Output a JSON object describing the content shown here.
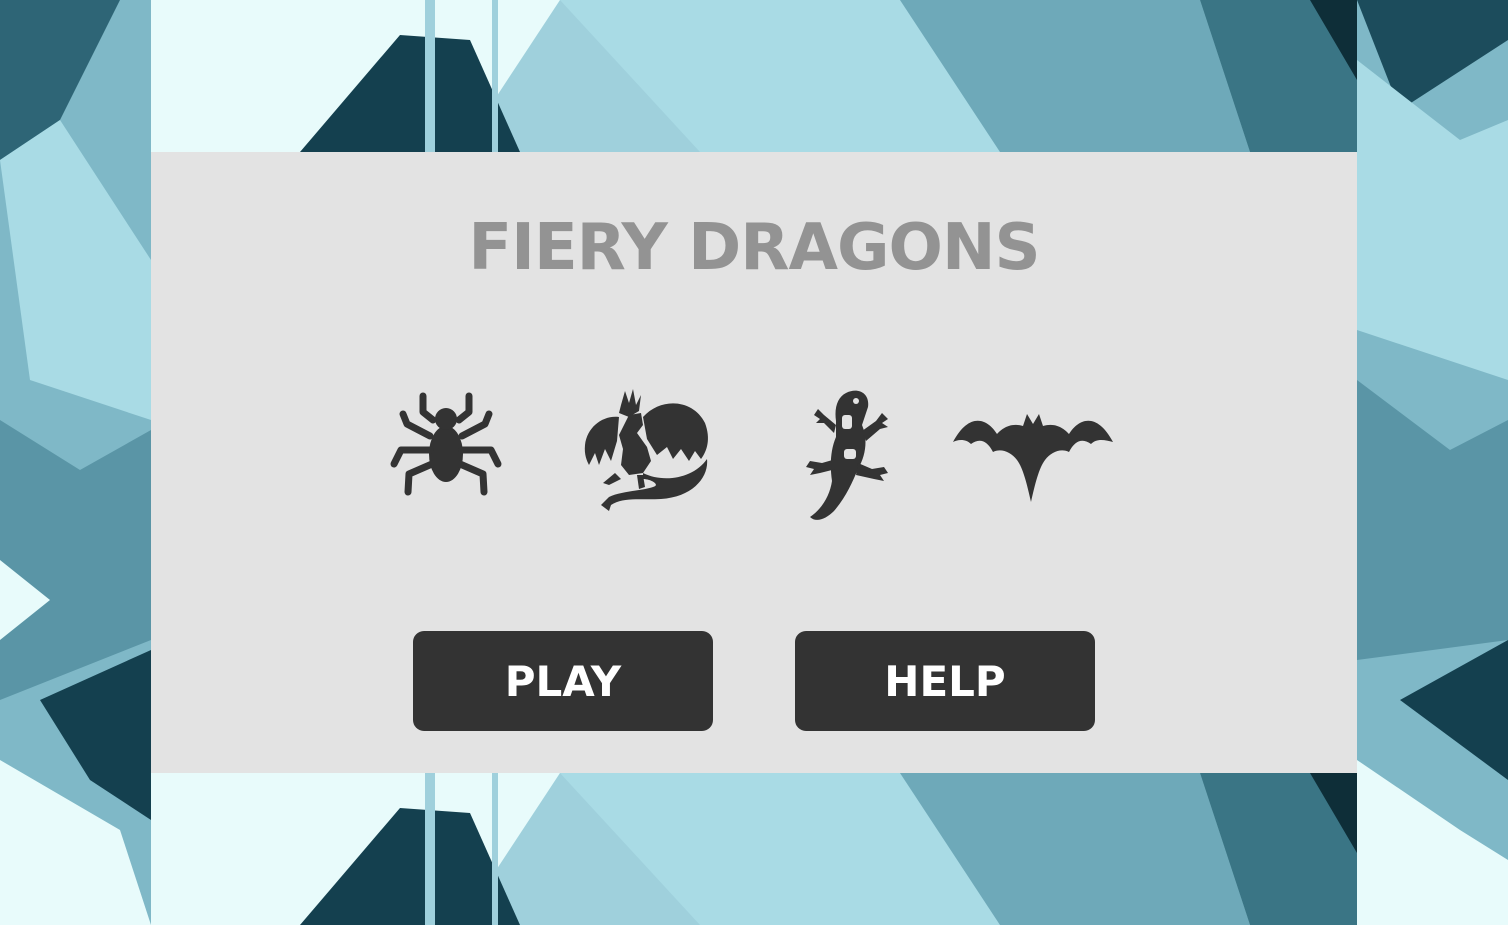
{
  "game": {
    "title": "FIERY DRAGONS"
  },
  "creatures": [
    {
      "icon": "spider-icon"
    },
    {
      "icon": "dragon-icon"
    },
    {
      "icon": "salamander-icon"
    },
    {
      "icon": "bat-icon"
    }
  ],
  "menu": {
    "play_label": "PLAY",
    "help_label": "HELP"
  },
  "colors": {
    "panel": "#e3e3e3",
    "title": "#939393",
    "button": "#333333",
    "button_text": "#ffffff",
    "icon": "#333333",
    "background_light": "#e8fbfb",
    "background_mid": "#8cc3d0",
    "background_dark": "#1e5060"
  }
}
